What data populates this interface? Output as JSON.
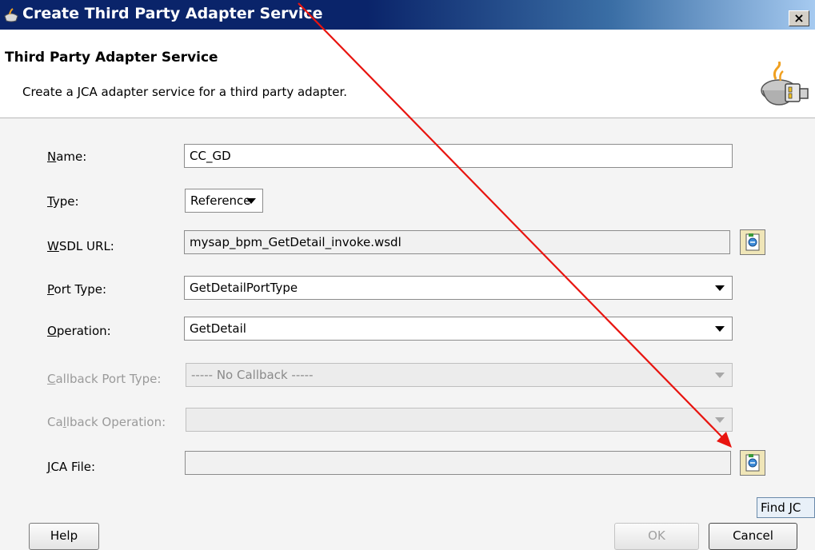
{
  "window": {
    "title": "Create Third Party Adapter Service",
    "close_label": "×"
  },
  "header": {
    "title": "Third Party Adapter Service",
    "subtitle": "Create a JCA adapter service for a third party adapter."
  },
  "form": {
    "name": {
      "mnemonic": "N",
      "rest": "ame:",
      "value": "CC_GD"
    },
    "type": {
      "mnemonic": "T",
      "rest": "ype:",
      "value": "Reference"
    },
    "wsdl_url": {
      "mnemonic": "W",
      "rest": "SDL URL:",
      "value": "mysap_bpm_GetDetail_invoke.wsdl"
    },
    "port_type": {
      "mnemonic": "P",
      "rest": "ort Type:",
      "value": "GetDetailPortType"
    },
    "operation": {
      "mnemonic": "O",
      "rest": "peration:",
      "value": "GetDetail"
    },
    "callback_port_type": {
      "mnemonic": "C",
      "rest": "allback Port Type:",
      "value": "----- No Callback -----"
    },
    "callback_operation": {
      "pre": "Ca",
      "mnemonic": "l",
      "rest": "lback Operation:",
      "value": ""
    },
    "jca_file": {
      "mnemonic": "J",
      "rest": "CA File:",
      "value": ""
    }
  },
  "tooltip": {
    "text": "Find JC"
  },
  "buttons": {
    "help": "Help",
    "ok": "OK",
    "cancel": "Cancel"
  },
  "annotation": {
    "color": "#e8140f"
  }
}
